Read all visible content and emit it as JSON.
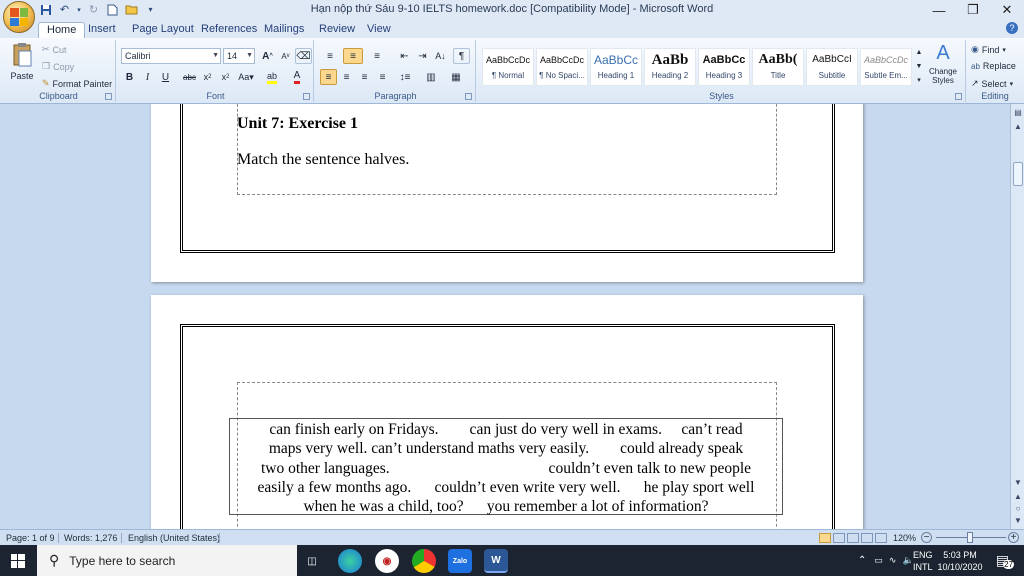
{
  "app": {
    "title": "Hạn nộp thứ Sáu 9-10 IELTS homework.doc [Compatibility Mode] - Microsoft Word"
  },
  "tabs": [
    "Home",
    "Insert",
    "Page Layout",
    "References",
    "Mailings",
    "Review",
    "View"
  ],
  "clipboard": {
    "paste": "Paste",
    "cut": "Cut",
    "copy": "Copy",
    "format_painter": "Format Painter",
    "label": "Clipboard"
  },
  "font": {
    "name": "Calibri",
    "size": "14",
    "label": "Font"
  },
  "paragraph": {
    "label": "Paragraph"
  },
  "styles": {
    "label": "Styles",
    "items": [
      {
        "sample": "AaBbCcDc",
        "name": "¶ Normal"
      },
      {
        "sample": "AaBbCcDc",
        "name": "¶ No Spaci..."
      },
      {
        "sample": "AaBbCc",
        "name": "Heading 1"
      },
      {
        "sample": "AaBb",
        "name": "Heading 2"
      },
      {
        "sample": "AaBbCc",
        "name": "Heading 3"
      },
      {
        "sample": "AaBb(",
        "name": "Title"
      },
      {
        "sample": "AaBbCcI",
        "name": "Subtitle"
      },
      {
        "sample": "AaBbCcDc",
        "name": "Subtle Em..."
      }
    ],
    "change_styles": "Change Styles"
  },
  "editing": {
    "find": "Find",
    "replace": "Replace",
    "select": "Select",
    "label": "Editing"
  },
  "document": {
    "heading": "Unit 7: Exercise 1",
    "instruction": "Match the sentence halves.",
    "answer_lines": [
      "can finish early on Fridays.        can just do very well in exams.     can’t read",
      "maps very well. can’t understand maths very easily.        could already speak",
      "two other languages.                                         couldn’t even talk to new people",
      "easily a few months ago.      couldn’t even write very well.      he play sport well",
      "when he was a child, too?      you remember a lot of information?"
    ]
  },
  "statusbar": {
    "page": "Page: 1 of 9",
    "words": "Words: 1,276",
    "language": "English (United States)",
    "zoom": "120%"
  },
  "taskbar": {
    "search_placeholder": "Type here to search",
    "lang1": "ENG",
    "lang2": "INTL",
    "time": "5:03 PM",
    "date": "10/10/2020",
    "notifications": "27",
    "zalo": "Zalo"
  },
  "colors": {
    "ribbon_bg": "#dce8f6",
    "doc_bg": "#c7d9ee",
    "taskbar_bg": "#1b2430"
  }
}
